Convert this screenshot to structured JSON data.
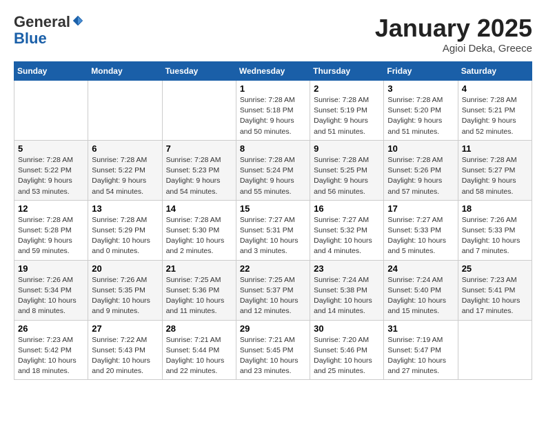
{
  "header": {
    "logo_general": "General",
    "logo_blue": "Blue",
    "month_title": "January 2025",
    "location": "Agioi Deka, Greece"
  },
  "weekdays": [
    "Sunday",
    "Monday",
    "Tuesday",
    "Wednesday",
    "Thursday",
    "Friday",
    "Saturday"
  ],
  "weeks": [
    [
      {
        "day": "",
        "info": ""
      },
      {
        "day": "",
        "info": ""
      },
      {
        "day": "",
        "info": ""
      },
      {
        "day": "1",
        "info": "Sunrise: 7:28 AM\nSunset: 5:18 PM\nDaylight: 9 hours\nand 50 minutes."
      },
      {
        "day": "2",
        "info": "Sunrise: 7:28 AM\nSunset: 5:19 PM\nDaylight: 9 hours\nand 51 minutes."
      },
      {
        "day": "3",
        "info": "Sunrise: 7:28 AM\nSunset: 5:20 PM\nDaylight: 9 hours\nand 51 minutes."
      },
      {
        "day": "4",
        "info": "Sunrise: 7:28 AM\nSunset: 5:21 PM\nDaylight: 9 hours\nand 52 minutes."
      }
    ],
    [
      {
        "day": "5",
        "info": "Sunrise: 7:28 AM\nSunset: 5:22 PM\nDaylight: 9 hours\nand 53 minutes."
      },
      {
        "day": "6",
        "info": "Sunrise: 7:28 AM\nSunset: 5:22 PM\nDaylight: 9 hours\nand 54 minutes."
      },
      {
        "day": "7",
        "info": "Sunrise: 7:28 AM\nSunset: 5:23 PM\nDaylight: 9 hours\nand 54 minutes."
      },
      {
        "day": "8",
        "info": "Sunrise: 7:28 AM\nSunset: 5:24 PM\nDaylight: 9 hours\nand 55 minutes."
      },
      {
        "day": "9",
        "info": "Sunrise: 7:28 AM\nSunset: 5:25 PM\nDaylight: 9 hours\nand 56 minutes."
      },
      {
        "day": "10",
        "info": "Sunrise: 7:28 AM\nSunset: 5:26 PM\nDaylight: 9 hours\nand 57 minutes."
      },
      {
        "day": "11",
        "info": "Sunrise: 7:28 AM\nSunset: 5:27 PM\nDaylight: 9 hours\nand 58 minutes."
      }
    ],
    [
      {
        "day": "12",
        "info": "Sunrise: 7:28 AM\nSunset: 5:28 PM\nDaylight: 9 hours\nand 59 minutes."
      },
      {
        "day": "13",
        "info": "Sunrise: 7:28 AM\nSunset: 5:29 PM\nDaylight: 10 hours\nand 0 minutes."
      },
      {
        "day": "14",
        "info": "Sunrise: 7:28 AM\nSunset: 5:30 PM\nDaylight: 10 hours\nand 2 minutes."
      },
      {
        "day": "15",
        "info": "Sunrise: 7:27 AM\nSunset: 5:31 PM\nDaylight: 10 hours\nand 3 minutes."
      },
      {
        "day": "16",
        "info": "Sunrise: 7:27 AM\nSunset: 5:32 PM\nDaylight: 10 hours\nand 4 minutes."
      },
      {
        "day": "17",
        "info": "Sunrise: 7:27 AM\nSunset: 5:33 PM\nDaylight: 10 hours\nand 5 minutes."
      },
      {
        "day": "18",
        "info": "Sunrise: 7:26 AM\nSunset: 5:33 PM\nDaylight: 10 hours\nand 7 minutes."
      }
    ],
    [
      {
        "day": "19",
        "info": "Sunrise: 7:26 AM\nSunset: 5:34 PM\nDaylight: 10 hours\nand 8 minutes."
      },
      {
        "day": "20",
        "info": "Sunrise: 7:26 AM\nSunset: 5:35 PM\nDaylight: 10 hours\nand 9 minutes."
      },
      {
        "day": "21",
        "info": "Sunrise: 7:25 AM\nSunset: 5:36 PM\nDaylight: 10 hours\nand 11 minutes."
      },
      {
        "day": "22",
        "info": "Sunrise: 7:25 AM\nSunset: 5:37 PM\nDaylight: 10 hours\nand 12 minutes."
      },
      {
        "day": "23",
        "info": "Sunrise: 7:24 AM\nSunset: 5:38 PM\nDaylight: 10 hours\nand 14 minutes."
      },
      {
        "day": "24",
        "info": "Sunrise: 7:24 AM\nSunset: 5:40 PM\nDaylight: 10 hours\nand 15 minutes."
      },
      {
        "day": "25",
        "info": "Sunrise: 7:23 AM\nSunset: 5:41 PM\nDaylight: 10 hours\nand 17 minutes."
      }
    ],
    [
      {
        "day": "26",
        "info": "Sunrise: 7:23 AM\nSunset: 5:42 PM\nDaylight: 10 hours\nand 18 minutes."
      },
      {
        "day": "27",
        "info": "Sunrise: 7:22 AM\nSunset: 5:43 PM\nDaylight: 10 hours\nand 20 minutes."
      },
      {
        "day": "28",
        "info": "Sunrise: 7:21 AM\nSunset: 5:44 PM\nDaylight: 10 hours\nand 22 minutes."
      },
      {
        "day": "29",
        "info": "Sunrise: 7:21 AM\nSunset: 5:45 PM\nDaylight: 10 hours\nand 23 minutes."
      },
      {
        "day": "30",
        "info": "Sunrise: 7:20 AM\nSunset: 5:46 PM\nDaylight: 10 hours\nand 25 minutes."
      },
      {
        "day": "31",
        "info": "Sunrise: 7:19 AM\nSunset: 5:47 PM\nDaylight: 10 hours\nand 27 minutes."
      },
      {
        "day": "",
        "info": ""
      }
    ]
  ]
}
